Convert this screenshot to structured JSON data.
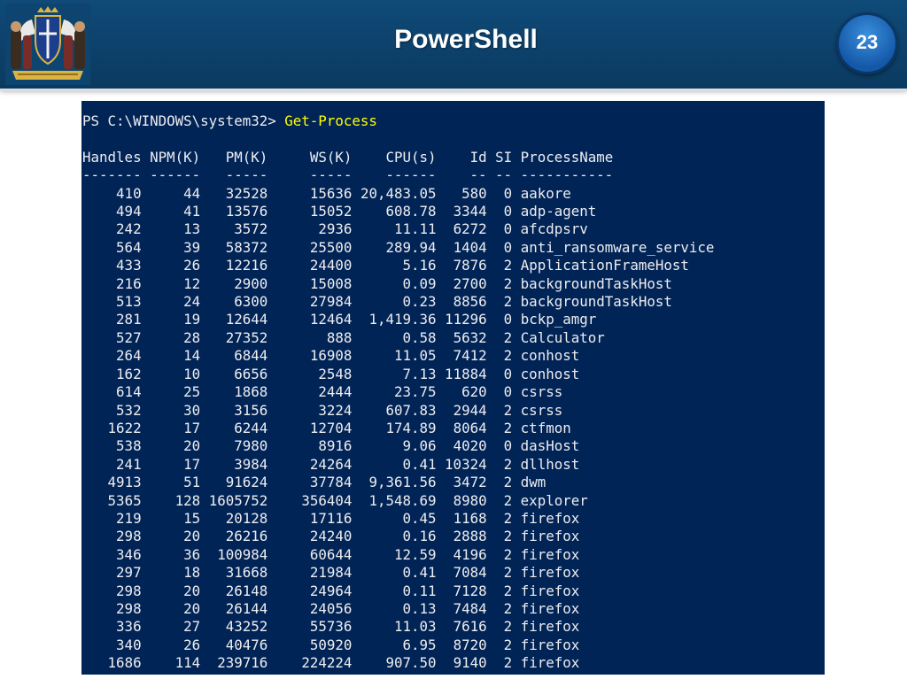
{
  "slide": {
    "title": "PowerShell",
    "number": "23",
    "emblem": "coat-of-arms-emblem"
  },
  "console": {
    "prompt": "PS C:\\WINDOWS\\system32> ",
    "command": "Get-Process",
    "headers": [
      "Handles",
      "NPM(K)",
      "PM(K)",
      "WS(K)",
      "CPU(s)",
      "Id",
      "SI",
      "ProcessName"
    ],
    "rows": [
      [
        "410",
        "44",
        "32528",
        "15636",
        "20,483.05",
        "580",
        "0",
        "aakore"
      ],
      [
        "494",
        "41",
        "13576",
        "15052",
        "608.78",
        "3344",
        "0",
        "adp-agent"
      ],
      [
        "242",
        "13",
        "3572",
        "2936",
        "11.11",
        "6272",
        "0",
        "afcdpsrv"
      ],
      [
        "564",
        "39",
        "58372",
        "25500",
        "289.94",
        "1404",
        "0",
        "anti_ransomware_service"
      ],
      [
        "433",
        "26",
        "12216",
        "24400",
        "5.16",
        "7876",
        "2",
        "ApplicationFrameHost"
      ],
      [
        "216",
        "12",
        "2900",
        "15008",
        "0.09",
        "2700",
        "2",
        "backgroundTaskHost"
      ],
      [
        "513",
        "24",
        "6300",
        "27984",
        "0.23",
        "8856",
        "2",
        "backgroundTaskHost"
      ],
      [
        "281",
        "19",
        "12644",
        "12464",
        "1,419.36",
        "11296",
        "0",
        "bckp_amgr"
      ],
      [
        "527",
        "28",
        "27352",
        "888",
        "0.58",
        "5632",
        "2",
        "Calculator"
      ],
      [
        "264",
        "14",
        "6844",
        "16908",
        "11.05",
        "7412",
        "2",
        "conhost"
      ],
      [
        "162",
        "10",
        "6656",
        "2548",
        "7.13",
        "11884",
        "0",
        "conhost"
      ],
      [
        "614",
        "25",
        "1868",
        "2444",
        "23.75",
        "620",
        "0",
        "csrss"
      ],
      [
        "532",
        "30",
        "3156",
        "3224",
        "607.83",
        "2944",
        "2",
        "csrss"
      ],
      [
        "1622",
        "17",
        "6244",
        "12704",
        "174.89",
        "8064",
        "2",
        "ctfmon"
      ],
      [
        "538",
        "20",
        "7980",
        "8916",
        "9.06",
        "4020",
        "0",
        "dasHost"
      ],
      [
        "241",
        "17",
        "3984",
        "24264",
        "0.41",
        "10324",
        "2",
        "dllhost"
      ],
      [
        "4913",
        "51",
        "91624",
        "37784",
        "9,361.56",
        "3472",
        "2",
        "dwm"
      ],
      [
        "5365",
        "128",
        "1605752",
        "356404",
        "1,548.69",
        "8980",
        "2",
        "explorer"
      ],
      [
        "219",
        "15",
        "20128",
        "17116",
        "0.45",
        "1168",
        "2",
        "firefox"
      ],
      [
        "298",
        "20",
        "26216",
        "24240",
        "0.16",
        "2888",
        "2",
        "firefox"
      ],
      [
        "346",
        "36",
        "100984",
        "60644",
        "12.59",
        "4196",
        "2",
        "firefox"
      ],
      [
        "297",
        "18",
        "31668",
        "21984",
        "0.41",
        "7084",
        "2",
        "firefox"
      ],
      [
        "298",
        "20",
        "26148",
        "24964",
        "0.11",
        "7128",
        "2",
        "firefox"
      ],
      [
        "298",
        "20",
        "26144",
        "24056",
        "0.13",
        "7484",
        "2",
        "firefox"
      ],
      [
        "336",
        "27",
        "43252",
        "55736",
        "11.03",
        "7616",
        "2",
        "firefox"
      ],
      [
        "340",
        "26",
        "40476",
        "50920",
        "6.95",
        "8720",
        "2",
        "firefox"
      ],
      [
        "1686",
        "114",
        "239716",
        "224224",
        "907.50",
        "9140",
        "2",
        "firefox"
      ]
    ]
  },
  "colors": {
    "header_bg": "#0f4a78",
    "console_bg": "#012456",
    "console_text": "#eeedf0",
    "command_text": "#ffff00",
    "badge": "#1e6fc4"
  }
}
